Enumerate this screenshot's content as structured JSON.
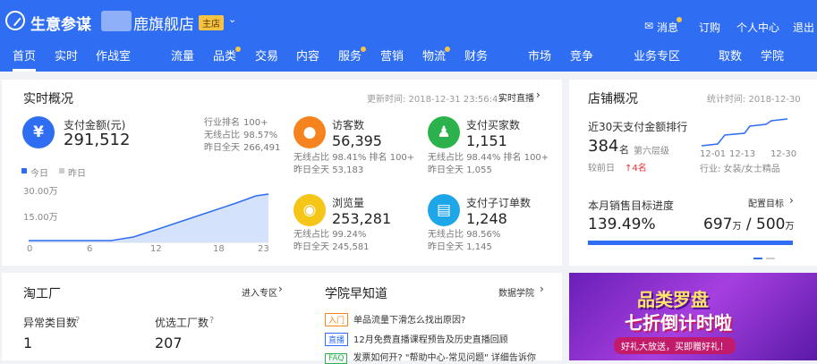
{
  "header": {
    "brand": "生意参谋",
    "shop": "鹿旗舰店",
    "badge": "主店",
    "msg": "消息",
    "order": "订购",
    "center": "个人中心",
    "logout": "退出"
  },
  "nav": [
    "首页",
    "实时",
    "作战室",
    "流量",
    "品类",
    "交易",
    "内容",
    "服务",
    "营销",
    "物流",
    "财务",
    "市场",
    "竞争",
    "业务专区",
    "取数",
    "学院"
  ],
  "realtime": {
    "title": "实时概况",
    "update": "更新时间: 2018-12-31 23:56:43",
    "live": "实时直播",
    "pay_label": "支付金额(元)",
    "pay_value": "291,512",
    "rank_label": "行业排名",
    "rank_value": "100+",
    "wx_label": "无线占比",
    "wx_value": "98.57%",
    "yday_label": "昨日全天",
    "yday_value": "266,491",
    "legend_today": "今日",
    "legend_yday": "昨日",
    "y1": "30.00万",
    "y2": "15.00万",
    "x": [
      "0",
      "6",
      "12",
      "18",
      "23"
    ],
    "visitors": {
      "label": "访客数",
      "value": "56,395",
      "l1": "无线占比",
      "v1": "98.41%",
      "l2": "排名",
      "v2": "100+",
      "l3": "昨日全天",
      "v3": "53,183"
    },
    "buyers": {
      "label": "支付买家数",
      "value": "1,151",
      "l1": "无线占比",
      "v1": "98.44%",
      "l2": "排名",
      "v2": "100+",
      "l3": "昨日全天",
      "v3": "1,055"
    },
    "pv": {
      "label": "浏览量",
      "value": "253,281",
      "l1": "无线占比",
      "v1": "99.24%",
      "l3": "昨日全天",
      "v3": "245,581"
    },
    "orders": {
      "label": "支付子订单数",
      "value": "1,248",
      "l1": "无线占比",
      "v1": "98.56%",
      "l3": "昨日全天",
      "v3": "1,145"
    }
  },
  "shop": {
    "title": "店铺概况",
    "stat": "统计时间: 2018-12-30",
    "rank_title": "近30天支付金额排行",
    "rank": "384",
    "rank_unit": "名",
    "level": "第六层级",
    "cmp": "较前日",
    "up": "↑4名",
    "x": [
      "12-01",
      "12-13",
      "12-30"
    ],
    "industry": "行业: 女装/女士精品",
    "goal_title": "本月销售目标进度",
    "config": "配置目标",
    "percent": "139.49%",
    "amount": "697",
    "unit": "万",
    "sep": " / ",
    "target": "500",
    "unit2": "万",
    "progress": 1.0
  },
  "factory": {
    "title": "淘工厂",
    "enter": "进入专区",
    "abn_label": "异常类目数",
    "abn_value": "1",
    "opt_label": "优选工厂数",
    "opt_value": "207"
  },
  "academy": {
    "title": "学院早知道",
    "more": "数据学院",
    "items": [
      {
        "tag": "入门",
        "text": "单品流量下滑怎么找出原因?"
      },
      {
        "tag": "直播",
        "text": "12月免费直播课程预告及历史直播回顾"
      },
      {
        "tag": "FAQ",
        "text": "发票如何开? \"帮助中心-常见问题\" 详细告诉你"
      }
    ]
  },
  "promo": {
    "t1": "品类罗盘",
    "t2": "七折倒计时啦",
    "t3": "好礼大放送，买即赠好礼！"
  },
  "colors": {
    "blue": "#2f6ef2",
    "orange": "#f5841f",
    "green": "#2bb24c",
    "yellow": "#f5c518",
    "cyan": "#1ea7e8"
  }
}
